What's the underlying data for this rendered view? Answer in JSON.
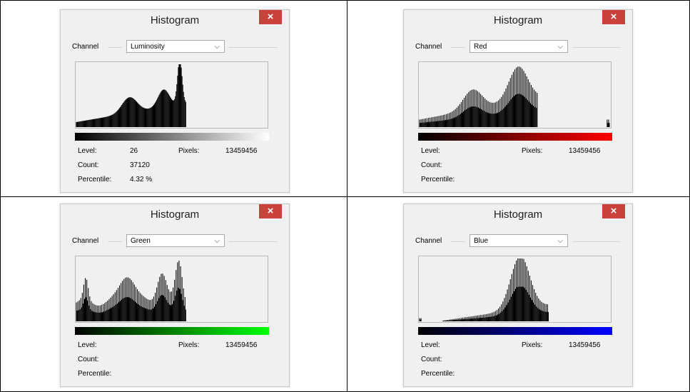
{
  "windows": [
    {
      "id": "luminosity",
      "title": "Histogram",
      "close_icon": "×",
      "channel_label": "Channel",
      "channel_value": "Luminosity",
      "chevron": "⌵",
      "gradient_to": "#ffffff",
      "level_label": "Level:",
      "level_value": "26",
      "pixels_label": "Pixels:",
      "pixels_value": "13459456",
      "count_label": "Count:",
      "count_value": "37120",
      "percentile_label": "Percentile:",
      "percentile_value": "4.32 %",
      "shape": "lum"
    },
    {
      "id": "red",
      "title": "Histogram",
      "close_icon": "×",
      "channel_label": "Channel",
      "channel_value": "Red",
      "chevron": "⌵",
      "gradient_to": "#ff0000",
      "level_label": "Level:",
      "level_value": "",
      "pixels_label": "Pixels:",
      "pixels_value": "13459456",
      "count_label": "Count:",
      "count_value": "",
      "percentile_label": "Percentile:",
      "percentile_value": "",
      "shape": "red"
    },
    {
      "id": "green",
      "title": "Histogram",
      "close_icon": "×",
      "channel_label": "Channel",
      "channel_value": "Green",
      "chevron": "⌵",
      "gradient_to": "#00ff00",
      "level_label": "Level:",
      "level_value": "",
      "pixels_label": "Pixels:",
      "pixels_value": "13459456",
      "count_label": "Count:",
      "count_value": "",
      "percentile_label": "Percentile:",
      "percentile_value": "",
      "shape": "green"
    },
    {
      "id": "blue",
      "title": "Histogram",
      "close_icon": "×",
      "channel_label": "Channel",
      "channel_value": "Blue",
      "chevron": "⌵",
      "gradient_to": "#0000ff",
      "level_label": "Level:",
      "level_value": "",
      "pixels_label": "Pixels:",
      "pixels_value": "13459456",
      "count_label": "Count:",
      "count_value": "",
      "percentile_label": "Percentile:",
      "percentile_value": "",
      "shape": "blue"
    }
  ]
}
